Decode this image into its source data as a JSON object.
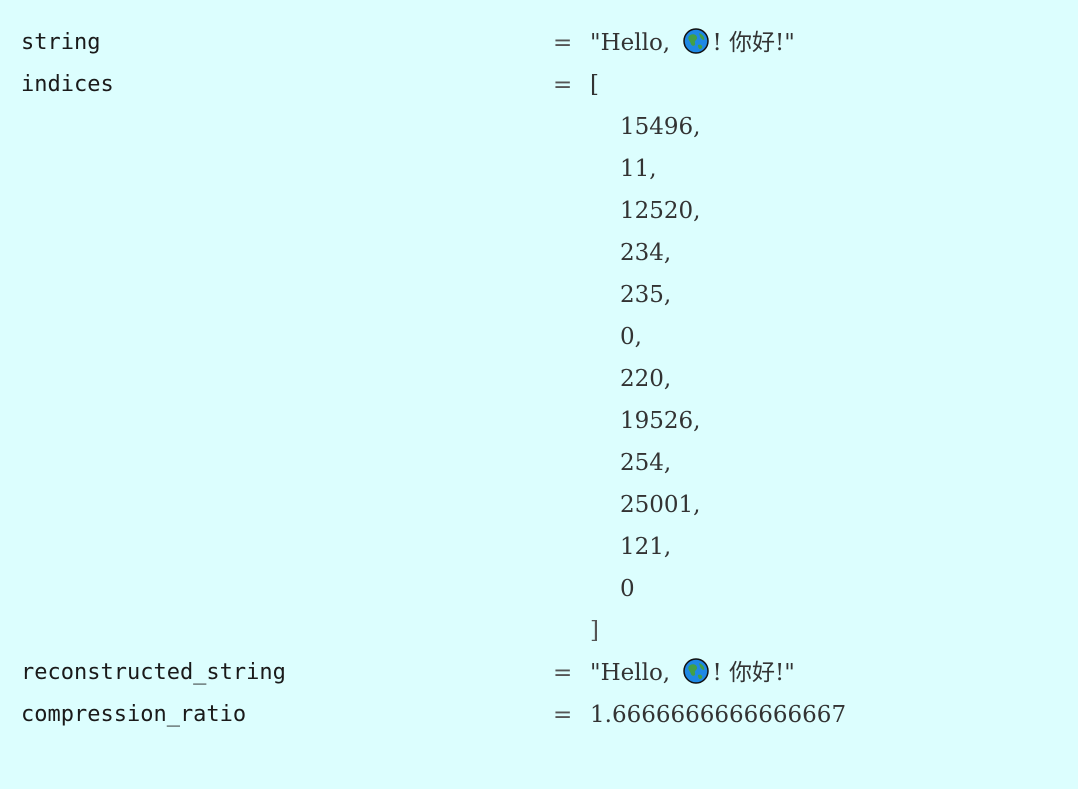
{
  "vars": {
    "string": {
      "key": "string",
      "eq": "=",
      "before": "\"Hello, ",
      "globe_icon": "earth-globe-emoji",
      "after": "! 你好!\""
    },
    "indices": {
      "key": "indices",
      "eq": "=",
      "open": "[",
      "items": [
        "15496,",
        "11,",
        "12520,",
        "234,",
        "235,",
        "0,",
        "220,",
        "19526,",
        "254,",
        "25001,",
        "121,",
        "0"
      ],
      "close": "]"
    },
    "reconstructed_string": {
      "key": "reconstructed_string",
      "eq": "=",
      "before": "\"Hello, ",
      "globe_icon": "earth-globe-emoji",
      "after": "! 你好!\""
    },
    "compression_ratio": {
      "key": "compression_ratio",
      "eq": "=",
      "value": "1.6666666666666667"
    }
  },
  "colors": {
    "background": "#dcfefe",
    "text": "#333333",
    "globe_ocean": "#1e88e5",
    "globe_land": "#43a047"
  }
}
